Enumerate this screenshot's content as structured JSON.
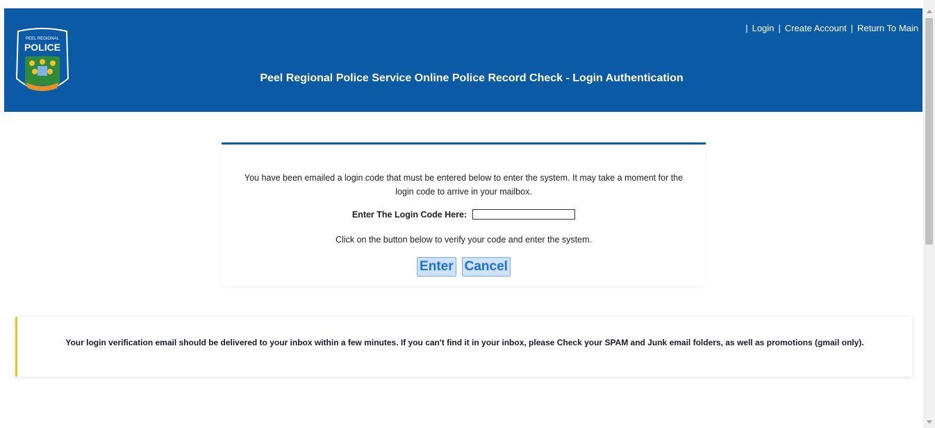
{
  "header": {
    "logo": {
      "top_text": "PEEL REGIONAL",
      "main_text": "POLICE"
    },
    "links": [
      {
        "label": "Login"
      },
      {
        "label": "Create Account"
      },
      {
        "label": "Return To Main"
      }
    ],
    "separator": "|",
    "title": "Peel Regional Police Service Online Police Record Check - Login Authentication"
  },
  "panel": {
    "message": "You have been emailed a login code that must be entered below to enter the system. It may take a moment for the login code to arrive in your mailbox.",
    "code_label": "Enter The Login Code Here:",
    "code_value": "",
    "verify_message": "Click on the button below to verify your code and enter the system.",
    "enter_label": "Enter",
    "cancel_label": "Cancel"
  },
  "notice": {
    "text": "Your login verification email should be delivered to your inbox within a few minutes. If you can't find it in your inbox, please Check your SPAM and Junk email folders, as well as promotions (gmail only)."
  },
  "colors": {
    "header_blue": "#0b5aa6",
    "notice_accent": "#f0c419",
    "button_text": "#1e6fe0"
  }
}
